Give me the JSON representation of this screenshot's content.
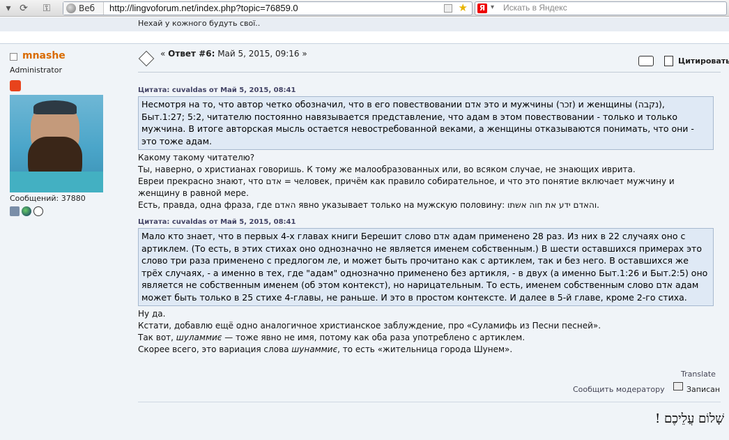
{
  "browser": {
    "web_chip": "Веб",
    "url": "http://lingvoforum.net/index.php?topic=76859.0",
    "search_logo": "Я",
    "search_placeholder": "Искать в Яндекс"
  },
  "previous_post_tail": "Нехай у кожного будуть свої..",
  "poster": {
    "name": "mnashe",
    "group": "Administrator",
    "posts": "Сообщений: 37880"
  },
  "post": {
    "header_prefix": "« ",
    "reply_label": "Ответ #6:",
    "date": " Май 5, 2015, 09:16 »",
    "quote_action": "Цитировать",
    "quote1_header": "Цитата: cuvaldas от Май  5, 2015, 08:41",
    "quote1_text": "Несмотря на то, что автор четко обозначил, что в его  повествовании אדם это и мужчины (זכר) и женщины (נקבה), Быт.1:27; 5:2, читателю постоянно навязывается представление, что адам в этом повествовании - только и  только мужчина. В итоге авторская мысль  остается невостребованной веками, а женщины отказываются понимать, что они - это тоже адам.",
    "reply1": [
      "Какому такому читателю?",
      "Ты, наверно, о христианах говоришь. К тому же малообразованных или, во всяком случае, не знающих иврита.",
      "Евреи прекрасно знают, что אדם = человек, причём как правило собирательное, и что это понятие включает мужчину и",
      "женщину в равной мере.",
      "Есть, правда, одна фраза, где האדם явно указывает только на мужскую половину: והאדם ידע את חוה אשתו."
    ],
    "quote2_header": "Цитата: cuvaldas от Май  5, 2015, 08:41",
    "quote2_text": "Мало кто знает, что в первых 4-х главах книги Берешит слово אדם адам применено 28 раз. Из них в 22 случаях оно с артиклем. (То есть, в этих стихах оно однозначно не является именем собственным.) В шести оставшихся примерах это слово три раза применено с предлогом ле, и может быть прочитано как с артиклем, так и без него. В оставшихся же трёх случаях, - а именно в тех, где \"адам\" однозначно применено без артикля, - в двух (а именно Быт.1:26 и Быт.2:5) оно является не собственным именем (об этом контекст), но нарицательным. То есть, именем собственным слово אדם адам может быть только в 25 стихе 4-главы, не раньше. И это в простом контексте. И далее в 5-й главе, кроме 2-го стиха.",
    "reply2_line1": "Ну да.",
    "reply2_line2": "Кстати, добавлю ещё одно аналогичное христианское заблуждение, про «Суламифь из Песни песней».",
    "reply2_line3_a": "Так вот, ",
    "reply2_line3_em": "шуламмиє",
    "reply2_line3_b": " — тоже явно не имя, потому как оба раза употреблено с артиклем.",
    "reply2_line4_a": "Скорее всего, это вариация слова ",
    "reply2_line4_em": "шунаммиє",
    "reply2_line4_b": ", то есть «жительница города Шунем».",
    "translate": "Translate",
    "report": "Сообщить модератору",
    "logged": "Записан",
    "signature": "שָׁלוֹם עֲלֵיכֶם !"
  }
}
